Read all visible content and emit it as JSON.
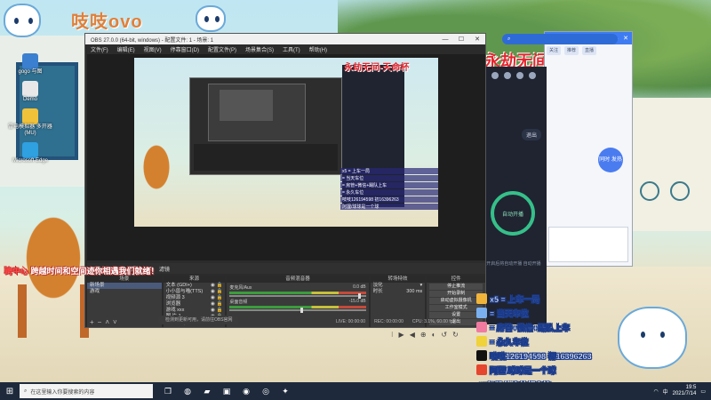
{
  "overlay": {
    "logo_text": "吱吱ovo",
    "banner": "永劫无间-天命杯",
    "left_caption_prefix": "跨中心",
    "left_caption": "跨越时间和空间迹你相遇我们就绪！",
    "footer_line": "15级粉丝滚着领房管",
    "items": [
      {
        "icon": "gift-icon",
        "color": "#f0b43a",
        "text": "x5 = 上车一局"
      },
      {
        "icon": "gift-icon",
        "color": "#7ab0f0",
        "text": "= 当天车位"
      },
      {
        "icon": "heart-icon",
        "color": "#f07aa0",
        "text": "= 房管+微信+踢队上车"
      },
      {
        "icon": "crown-icon",
        "color": "#f0d23a",
        "text": "= 永久车位"
      },
      {
        "icon": "tiktok-icon",
        "color": "#111111",
        "text": "吱吱126194598 初16396263"
      },
      {
        "icon": "weibo-icon",
        "color": "#e6452e",
        "text": "阿狸/球球是一个球"
      }
    ]
  },
  "desktop_icons": [
    {
      "label": "gogo 与图",
      "color": "#3b7fd0"
    },
    {
      "label": "Demo",
      "color": "#e8e8e8"
    },
    {
      "label": "雷电模拟器 多开器(MU)",
      "color": "#f0c23a"
    },
    {
      "label": "Microsoft Edge",
      "color": "#2fa0e0"
    }
  ],
  "obs": {
    "title": "OBS 27.0.0 (64-bit, windows) - 配置文件: 1 - 场景: 1",
    "menu": [
      "文件(F)",
      "编辑(E)",
      "视图(V)",
      "停靠窗口(D)",
      "配置文件(P)",
      "场景集合(S)",
      "工具(T)",
      "帮助(H)"
    ],
    "toolbar": [
      "不选择源",
      "属性",
      "滤镜"
    ],
    "docks": {
      "scenes_header": "场景",
      "scenes": [
        "新场景",
        "游戏"
      ],
      "sources_header": "来源",
      "sources": [
        "文本 (GDI+)",
        "小小兽与喵(TTS)",
        "视频源 3",
        "浏览器",
        "游戏 xxx",
        "图 片 1"
      ],
      "mixer_header": "音频混音器",
      "mixer": [
        {
          "name": "麦克风/Aux",
          "db": "0.0 dB"
        },
        {
          "name": "桌面音频",
          "db": "-15.0 dB"
        }
      ],
      "transition_header": "转场特效",
      "transition_value": "淡化",
      "duration_label": "时长",
      "duration_value": "300 ms",
      "controls_header": "控件",
      "controls": [
        "停止推流",
        "开始录制",
        "启动虚拟摄像机",
        "工作室模式",
        "设置",
        "退出"
      ]
    },
    "status": {
      "live": "LIVE: 00:00:00",
      "rec": "REC: 00:00:00",
      "cpu": "CPU: 3.1%, 60.00 fps"
    },
    "notice": "检测到更新可用，请前往OBS官网"
  },
  "phone_panel": {
    "exit_label": "退出",
    "circle_label": "自动开播",
    "hint": "开启后将自动开播 自动开播"
  },
  "chat_window": {
    "tabs": [
      "关注",
      "推荐",
      "直播"
    ],
    "badge": "同时 发热"
  },
  "search_pill": {
    "icon": "search-icon",
    "text": ""
  },
  "taskbar": {
    "search_placeholder": "在这里输入你要搜索的内容",
    "apps": [
      "task-view-icon",
      "edge-icon",
      "folder-icon",
      "store-icon",
      "steam-icon",
      "obs-icon",
      "game-icon"
    ],
    "time": "19:5",
    "date": "2021/7/14",
    "ime": "中",
    "network": "wifi-icon"
  },
  "media_controls": [
    "⁝",
    "▶",
    "◀",
    "⊕",
    "◐",
    "↺",
    "↻"
  ]
}
